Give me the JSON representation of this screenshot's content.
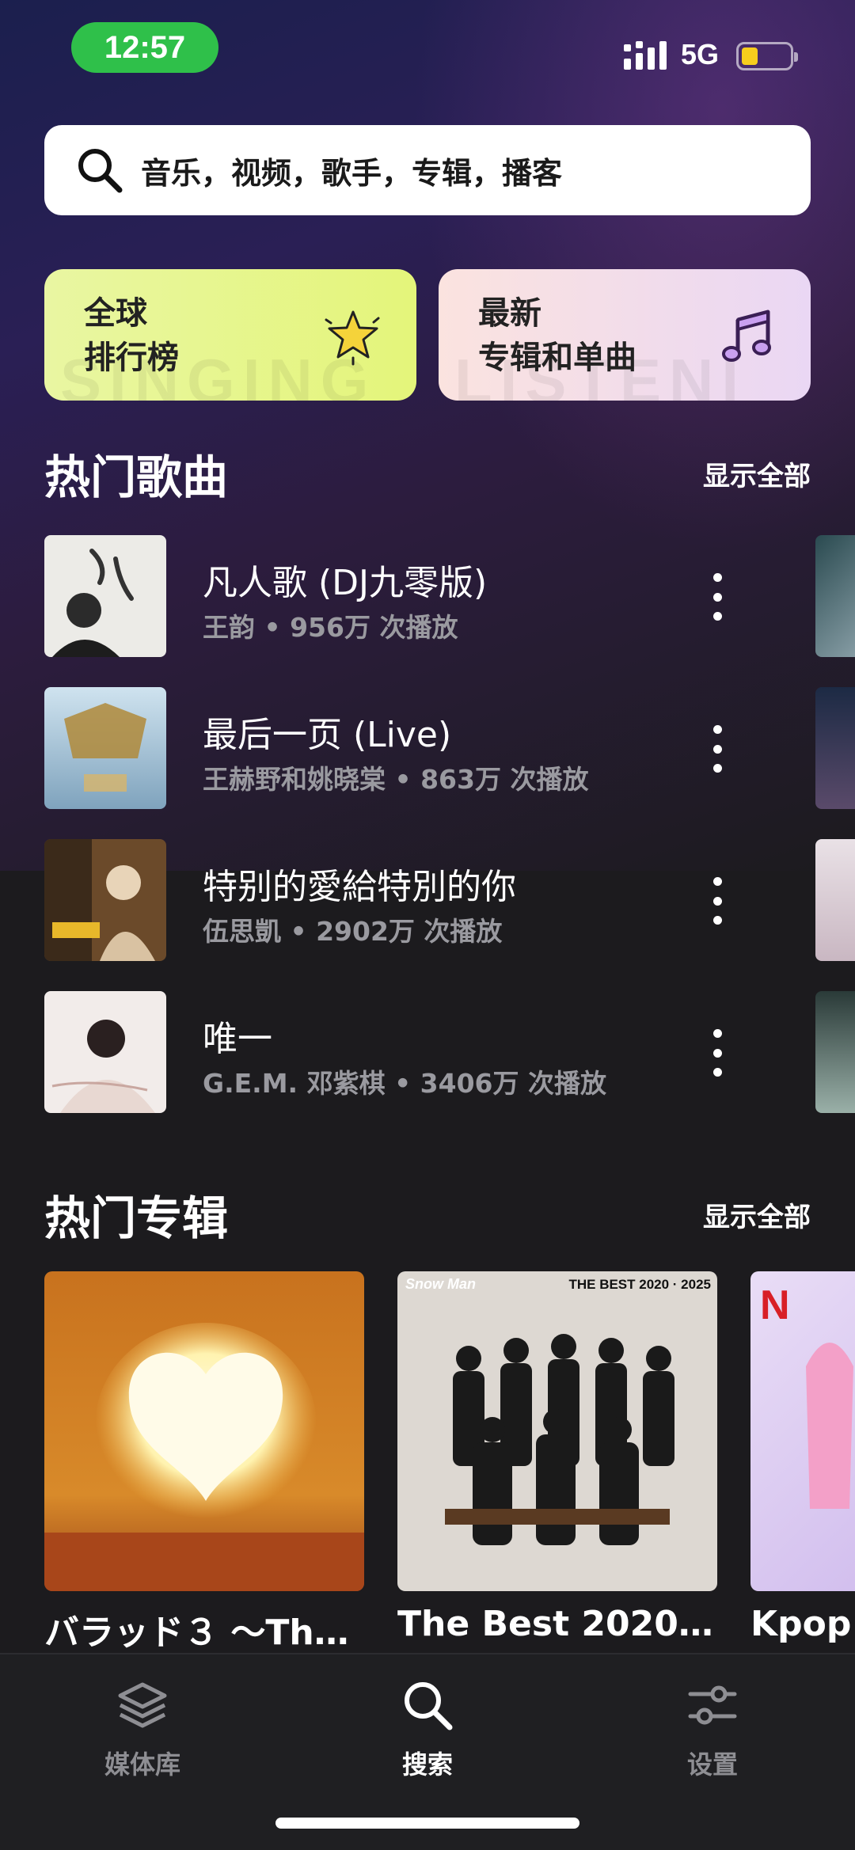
{
  "status_bar": {
    "time": "12:57",
    "network": "5G",
    "battery_level": 0.35,
    "colors": {
      "time_pill": "#2fc04a",
      "battery": "#f7cd1d"
    }
  },
  "search": {
    "icon": "search-icon",
    "placeholder": "音乐，视频，歌手，专辑，播客"
  },
  "feature_cards": [
    {
      "line1": "全球",
      "line2": "排行榜",
      "watermark": "SINGING",
      "icon": "star-icon",
      "color": "#e6f68c"
    },
    {
      "line1": "最新",
      "line2": "专辑和单曲",
      "watermark": "LISTENI",
      "icon": "music-note-icon",
      "color": "#f1dcea"
    }
  ],
  "hot_songs": {
    "title": "热门歌曲",
    "show_all": "显示全部",
    "items": [
      {
        "title": "凡人歌 (DJ九零版)",
        "artist": "王韵",
        "plays": "956万 次播放"
      },
      {
        "title": "最后一页 (Live)",
        "artist": "王赫野和姚晓棠",
        "plays": "863万 次播放"
      },
      {
        "title": "特别的愛給特別的你",
        "artist": "伍思凱",
        "plays": "2902万 次播放"
      },
      {
        "title": "唯一",
        "artist": "G.E.M. 邓紫棋",
        "plays": "3406万 次播放"
      }
    ]
  },
  "hot_albums": {
    "title": "热门专辑",
    "show_all": "显示全部",
    "items": [
      {
        "title": "バラッド３ ～The..."
      },
      {
        "title": "The Best 2020 -...",
        "cover_brand": "Snow Man",
        "cover_text": "THE BEST 2020 · 2025"
      },
      {
        "title": "Kpop D",
        "cover_brand": "N"
      }
    ]
  },
  "tab_bar": {
    "tabs": [
      {
        "label": "媒体库",
        "icon": "layers-icon",
        "active": false
      },
      {
        "label": "搜索",
        "icon": "search-icon",
        "active": true
      },
      {
        "label": "设置",
        "icon": "sliders-icon",
        "active": false
      }
    ]
  }
}
